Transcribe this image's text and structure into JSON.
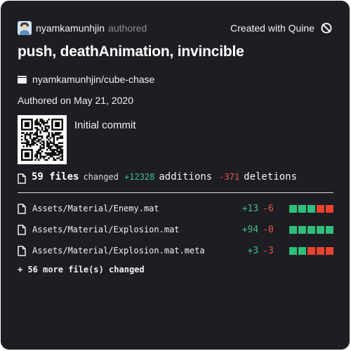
{
  "header": {
    "username": "nyamkamunhjin",
    "authored_word": "authored",
    "created_with": "Created with Quine"
  },
  "commit": {
    "title": "push, deathAnimation, invincible",
    "repo": "nyamkamunhjin/cube-chase",
    "date": "Authored on May 21, 2020",
    "message": "Initial commit"
  },
  "stats": {
    "files": "59 files",
    "changed": "changed",
    "additions": "+12328",
    "additions_word": "additions",
    "deletions": "-371",
    "deletions_word": "deletions"
  },
  "files": [
    {
      "name": "Assets/Material/Enemy.mat",
      "added": "+13",
      "deleted": "-6",
      "blocks": [
        "green",
        "green",
        "green",
        "red",
        "red"
      ]
    },
    {
      "name": "Assets/Material/Explosion.mat",
      "added": "+94",
      "deleted": "-0",
      "blocks": [
        "green",
        "green",
        "green",
        "green",
        "green"
      ]
    },
    {
      "name": "Assets/Material/Explosion.mat.meta",
      "added": "+3",
      "deleted": "-3",
      "blocks": [
        "green",
        "green",
        "red",
        "red",
        "red"
      ]
    }
  ],
  "more_files": "+ 56 more file(s) changed",
  "colors": {
    "background": "#1e1d23",
    "addition": "#3ec08a",
    "deletion": "#e25d4f",
    "block_green": "#2ec07b",
    "block_red": "#e8432e"
  },
  "icons": {
    "avatar": "user-avatar",
    "quine": "quine-logo-icon",
    "repo": "repo-icon",
    "file": "file-icon"
  }
}
